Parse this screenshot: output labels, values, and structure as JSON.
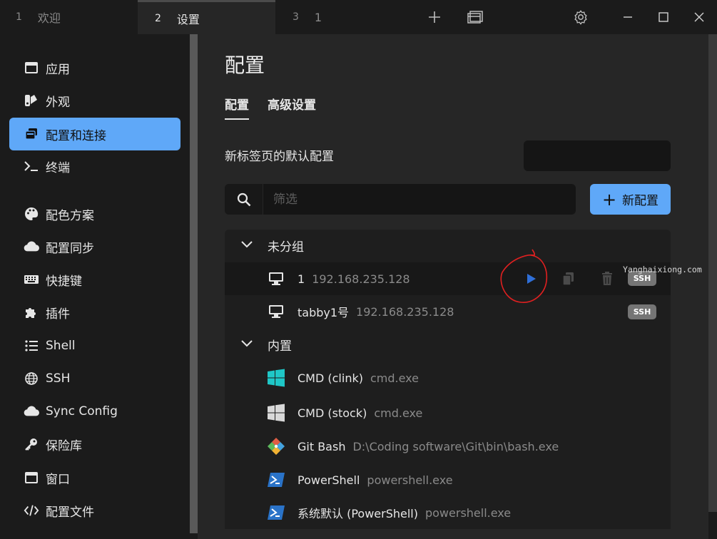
{
  "tabs": [
    {
      "num": "1",
      "label": "欢迎"
    },
    {
      "num": "2",
      "label": "设置"
    },
    {
      "num": "3",
      "label": "1"
    }
  ],
  "titlebar": {
    "add_icon": "plus-icon",
    "window_icon": "windows-icon",
    "settings_icon": "gear-icon",
    "minimize_icon": "minimize-icon",
    "maximize_icon": "maximize-icon",
    "close_icon": "close-icon"
  },
  "sidebar": {
    "items": [
      {
        "label": "应用",
        "icon": "app-window-icon"
      },
      {
        "label": "外观",
        "icon": "swatches-icon"
      },
      {
        "label": "配置和连接",
        "icon": "profiles-icon",
        "active": true
      },
      {
        "label": "终端",
        "icon": "terminal-icon"
      },
      {
        "label": "配色方案",
        "icon": "palette-icon"
      },
      {
        "label": "配置同步",
        "icon": "cloud-icon"
      },
      {
        "label": "快捷键",
        "icon": "keyboard-icon"
      },
      {
        "label": "插件",
        "icon": "puzzle-icon"
      },
      {
        "label": "Shell",
        "icon": "list-icon"
      },
      {
        "label": "SSH",
        "icon": "globe-icon"
      },
      {
        "label": "Sync Config",
        "icon": "cloud-icon"
      },
      {
        "label": "保险库",
        "icon": "key-icon"
      },
      {
        "label": "窗口",
        "icon": "window-icon"
      },
      {
        "label": "配置文件",
        "icon": "code-icon"
      }
    ]
  },
  "main": {
    "title": "配置",
    "subtabs": [
      {
        "label": "配置",
        "active": true
      },
      {
        "label": "高级设置"
      }
    ],
    "default_profile_label": "新标签页的默认配置",
    "search": {
      "placeholder": "筛选",
      "value": ""
    },
    "new_button_label": "新配置",
    "groups": [
      {
        "name": "未分组",
        "profiles": [
          {
            "name": "1",
            "desc": "192.168.235.128",
            "icon": "monitor-icon",
            "badge": "SSH",
            "hovered": true
          },
          {
            "name": "tabby1号",
            "desc": "192.168.235.128",
            "icon": "monitor-icon",
            "badge": "SSH"
          }
        ]
      },
      {
        "name": "内置",
        "profiles": [
          {
            "name": "CMD (clink)",
            "desc": "cmd.exe",
            "icon": "windows-logo-icon"
          },
          {
            "name": "CMD (stock)",
            "desc": "cmd.exe",
            "icon": "windows-logo-icon"
          },
          {
            "name": "Git Bash",
            "desc": "D:\\Coding software\\Git\\bin\\bash.exe",
            "icon": "git-icon"
          },
          {
            "name": "PowerShell",
            "desc": "powershell.exe",
            "icon": "powershell-icon"
          },
          {
            "name": "系统默认 (PowerShell)",
            "desc": "powershell.exe",
            "icon": "powershell-icon"
          }
        ]
      }
    ]
  },
  "watermark": "Yanghaixiong.com",
  "colors": {
    "accent": "#5fa8f8",
    "annotation": "#e02020",
    "play": "#2f6fd8",
    "cmd_clink": "#1fc7c7"
  }
}
